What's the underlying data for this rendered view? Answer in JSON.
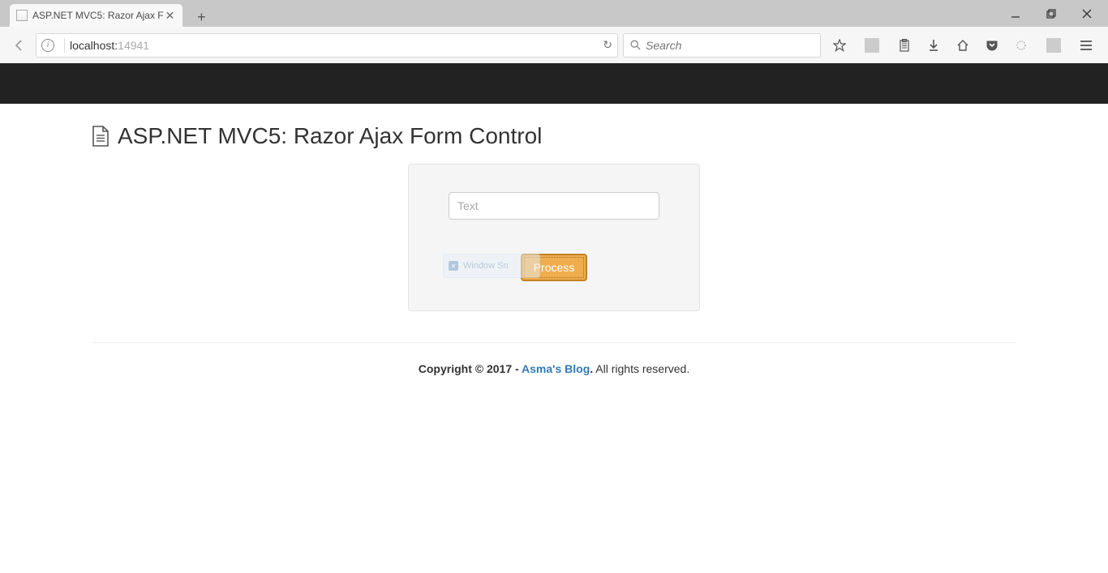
{
  "browser": {
    "tab_title": "ASP.NET MVC5: Razor Ajax F",
    "url_host": "localhost:",
    "url_port": "14941",
    "search_placeholder": "Search"
  },
  "page": {
    "title": "ASP.NET MVC5: Razor Ajax Form Control",
    "input_placeholder": "Text",
    "input_value": "",
    "process_label": "Process",
    "ghost_label": "Window Sn"
  },
  "footer": {
    "copyright": "Copyright © 2017 - ",
    "blog_name": "Asma's Blog",
    "rights": " All rights reserved."
  }
}
